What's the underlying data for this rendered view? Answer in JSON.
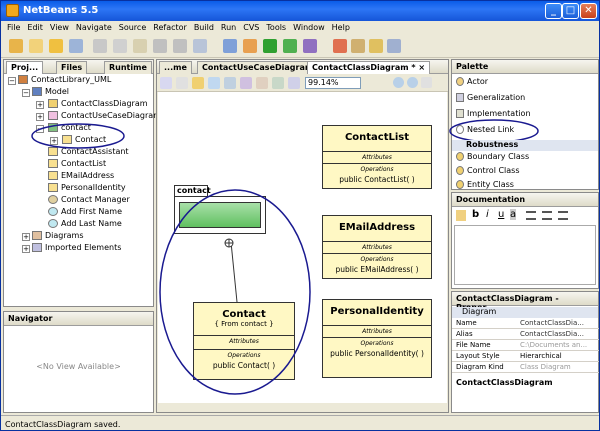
{
  "app": {
    "title": "NetBeans 5.5"
  },
  "window_buttons": {
    "minimize": "_",
    "maximize": "□",
    "close": "✕"
  },
  "menu": [
    "File",
    "Edit",
    "View",
    "Navigate",
    "Source",
    "Refactor",
    "Build",
    "Run",
    "CVS",
    "Tools",
    "Window",
    "Help"
  ],
  "projects": {
    "tabs": [
      "Proj...",
      "Files",
      "Runtime"
    ],
    "tree": [
      "ContactLibrary_UML",
      "Model",
      "ContactClassDiagram",
      "ContactUseCaseDiagram",
      "contact",
      "Contact",
      "ContactAssistant",
      "ContactList",
      "EMailAddress",
      "PersonalIdentity",
      "Contact Manager",
      "Add First Name",
      "Add Last Name",
      "Diagrams",
      "Imported Elements"
    ]
  },
  "editor": {
    "tabs": [
      "...me",
      "ContactUseCaseDiagram *",
      "ContactClassDiagram *"
    ],
    "tab_close": "×",
    "zoom": "99.14%"
  },
  "diagram": {
    "package": "contact",
    "classes": [
      {
        "name": "ContactList",
        "attr": "Attributes",
        "ops": "Operations",
        "op": "public ContactList( )"
      },
      {
        "name": "EMailAddress",
        "attr": "Attributes",
        "ops": "Operations",
        "op": "public EMailAddress( )"
      },
      {
        "name": "PersonalIdentity",
        "attr": "Attributes",
        "ops": "Operations",
        "op": "public PersonalIdentity( )"
      }
    ],
    "contact": {
      "name": "Contact",
      "sub": "{ From contact }",
      "attr": "Attributes",
      "ops": "Operations",
      "op": "public Contact( )"
    }
  },
  "navigator": {
    "title": "Navigator",
    "empty": "<No View Available>"
  },
  "palette": {
    "title": "Palette",
    "items": [
      "Actor",
      "Generalization",
      "Implementation",
      "Nested Link"
    ],
    "section": "Robustness",
    "items2": [
      "Boundary Class",
      "Control Class",
      "Entity Class"
    ]
  },
  "documentation": {
    "title": "Documentation",
    "buttons": [
      "b",
      "i",
      "u",
      "a"
    ]
  },
  "properties": {
    "title": "ContactClassDiagram - Proper...",
    "group": "Diagram",
    "rows": [
      [
        "Name",
        "ContactClassDia..."
      ],
      [
        "Alias",
        "ContactClassDia..."
      ],
      [
        "File Name",
        "C:\\Documents an..."
      ],
      [
        "Layout Style",
        "Hierarchical"
      ],
      [
        "Diagram Kind",
        "Class Diagram"
      ]
    ],
    "footer": "ContactClassDiagram"
  },
  "status": "ContactClassDiagram saved."
}
